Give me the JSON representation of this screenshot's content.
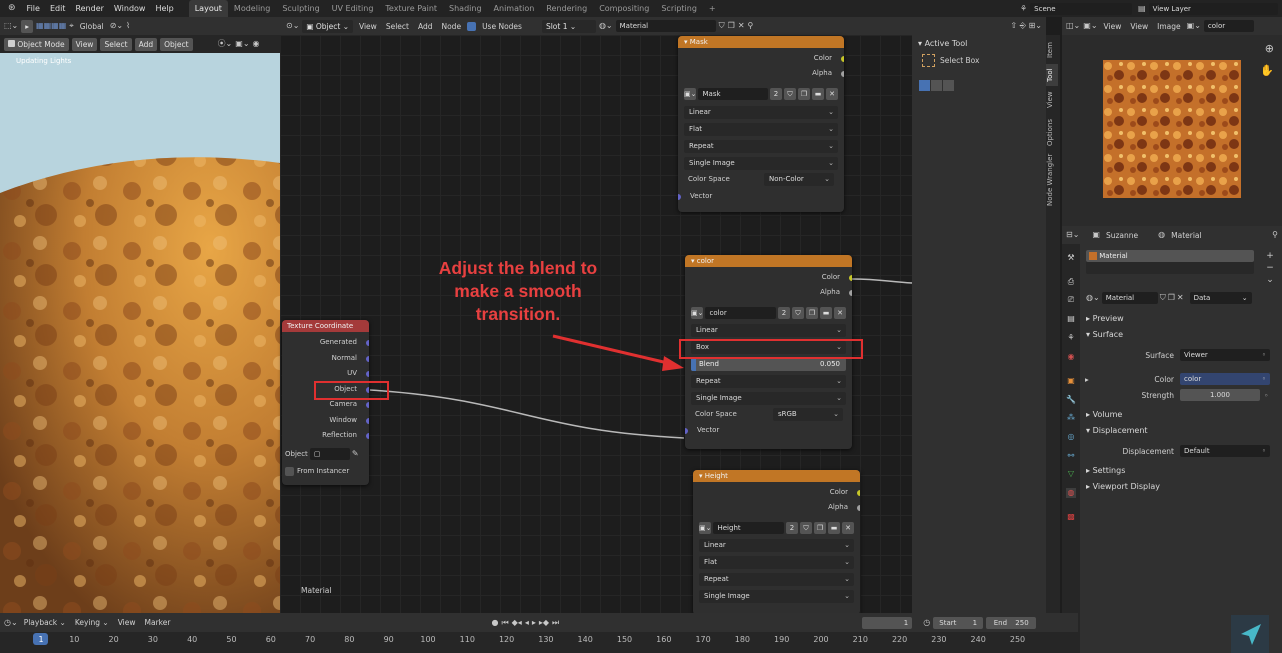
{
  "menu": [
    "File",
    "Edit",
    "Render",
    "Window",
    "Help"
  ],
  "workspaces": [
    "Layout",
    "Modeling",
    "Sculpting",
    "UV Editing",
    "Texture Paint",
    "Shading",
    "Animation",
    "Rendering",
    "Compositing",
    "Scripting"
  ],
  "active_workspace": "Layout",
  "scene": "Scene",
  "view_layer": "View Layer",
  "viewport": {
    "mode": "Object Mode",
    "buttons": [
      "View",
      "Select",
      "Add",
      "Object"
    ],
    "transform": "Global",
    "status_text": "Updating Lights"
  },
  "node_editor": {
    "type": "Object",
    "menus": [
      "View",
      "Select",
      "Add",
      "Node"
    ],
    "use_nodes": "Use Nodes",
    "slot": "Slot 1",
    "material": "Material",
    "footer_label": "Material"
  },
  "nodes": {
    "mask": {
      "title": "Mask",
      "outputs": [
        "Color",
        "Alpha"
      ],
      "image": "Mask",
      "users": "2",
      "interpolation": "Linear",
      "projection": "Flat",
      "extension": "Repeat",
      "source": "Single Image",
      "color_space_label": "Color Space",
      "color_space": "Non-Color",
      "input": "Vector"
    },
    "color": {
      "title": "color",
      "outputs": [
        "Color",
        "Alpha"
      ],
      "image": "color",
      "users": "2",
      "interpolation": "Linear",
      "projection": "Box",
      "blend_label": "Blend",
      "blend_value": "0.050",
      "extension": "Repeat",
      "source": "Single Image",
      "color_space_label": "Color Space",
      "color_space": "sRGB",
      "input": "Vector"
    },
    "height": {
      "title": "Height",
      "outputs": [
        "Color",
        "Alpha"
      ],
      "image": "Height",
      "users": "2",
      "interpolation": "Linear",
      "projection": "Flat",
      "extension": "Repeat",
      "source": "Single Image"
    },
    "texcoord": {
      "title": "Texture Coordinate",
      "outputs": [
        "Generated",
        "Normal",
        "UV",
        "Object",
        "Camera",
        "Window",
        "Reflection"
      ],
      "object_label": "Object",
      "from_instancer": "From Instancer"
    }
  },
  "annotation": {
    "text": "Adjust the blend to make a smooth transition.",
    "color": "#e84040"
  },
  "sidebar": {
    "tabs": [
      "Item",
      "Tool",
      "View",
      "Options",
      "Node Wrangler"
    ],
    "active_tool_title": "Active Tool",
    "tool_name": "Select Box"
  },
  "image_editor": {
    "menus": [
      "View",
      "View",
      "Image"
    ],
    "image": "color"
  },
  "properties": {
    "object": "Suzanne",
    "material_tab": "Material",
    "material_slot": "Material",
    "material_name": "Material",
    "data_mode": "Data",
    "preview": "Preview",
    "surface_section": "Surface",
    "surface_label": "Surface",
    "surface_value": "Viewer",
    "color_label": "Color",
    "color_value": "color",
    "strength_label": "Strength",
    "strength_value": "1.000",
    "volume": "Volume",
    "displacement_section": "Displacement",
    "displacement_label": "Displacement",
    "displacement_value": "Default",
    "settings": "Settings",
    "viewport_display": "Viewport Display"
  },
  "timeline": {
    "menus": [
      "Playback",
      "Keying",
      "View",
      "Marker"
    ],
    "current_frame": "1",
    "start_label": "Start",
    "start": "1",
    "end_label": "End",
    "end": "250",
    "ticks": [
      "1",
      "10",
      "20",
      "30",
      "40",
      "50",
      "60",
      "70",
      "80",
      "90",
      "100",
      "110",
      "120",
      "130",
      "140",
      "150",
      "160",
      "170",
      "180",
      "190",
      "200",
      "210",
      "220",
      "230",
      "240",
      "250"
    ]
  },
  "colors": {
    "node_orange": "#c17625",
    "node_red": "#a43a3a",
    "accent_blue": "#4772b3",
    "highlight_red": "#e03030"
  }
}
